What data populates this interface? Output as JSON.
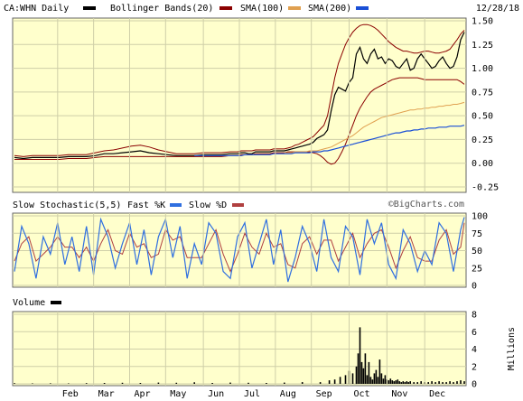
{
  "header": {
    "symbol_label": "CA:WHN Daily",
    "bb_label": "Bollinger Bands(20)",
    "sma100_label": "SMA(100)",
    "sma200_label": "SMA(200)",
    "date_label": "12/28/18"
  },
  "stoch_header": {
    "title": "Slow Stochastic(5,5)",
    "fast_label": "Fast %K",
    "slow_label": "Slow %D"
  },
  "volume_header": {
    "title": "Volume"
  },
  "watermark": "©BigCharts.com",
  "colors": {
    "panel_bg": "#ffffcc",
    "price": "#000000",
    "bollinger": "#8b0000",
    "sma100": "#e0a050",
    "sma200": "#1a4fd6",
    "fast_k": "#2f6fe0",
    "slow_d": "#b04040",
    "volume": "#000000"
  },
  "chart_data": [
    {
      "type": "line",
      "name": "price",
      "x_ticks": [
        "Feb",
        "Mar",
        "Apr",
        "May",
        "Jun",
        "Jul",
        "Aug",
        "Sep",
        "Oct",
        "Nov",
        "Dec"
      ],
      "y_ticks": [
        "1.50",
        "1.25",
        "1.00",
        "0.75",
        "0.50",
        "0.25",
        "0.00",
        "-0.25"
      ],
      "ylim": [
        -0.25,
        1.5
      ],
      "x_points": [
        0,
        10,
        20,
        30,
        40,
        50,
        60,
        70,
        80,
        90,
        100,
        110,
        120,
        130,
        140,
        150,
        160,
        170,
        180,
        190,
        200,
        210,
        220,
        230,
        240,
        248,
        252,
        256,
        260,
        264,
        268,
        272,
        276,
        280,
        284,
        288,
        292,
        296,
        300,
        304,
        308,
        312,
        316,
        320,
        324,
        328,
        332,
        336,
        340,
        344,
        348,
        352,
        356,
        360,
        364,
        368,
        372,
        376,
        380,
        384,
        388,
        392,
        396,
        400,
        404,
        408,
        412,
        416,
        420,
        424,
        428,
        432,
        436,
        440,
        444,
        448,
        452,
        456,
        460,
        464,
        468,
        472,
        476,
        480,
        484,
        488,
        492,
        496,
        500
      ],
      "series": [
        {
          "name": "CA:WHN Daily",
          "values": [
            0.06,
            0.05,
            0.06,
            0.06,
            0.06,
            0.06,
            0.07,
            0.07,
            0.07,
            0.08,
            0.1,
            0.1,
            0.11,
            0.12,
            0.13,
            0.11,
            0.1,
            0.09,
            0.08,
            0.08,
            0.08,
            0.09,
            0.09,
            0.09,
            0.1,
            0.1,
            0.11,
            0.11,
            0.1,
            0.1,
            0.12,
            0.12,
            0.12,
            0.12,
            0.12,
            0.13,
            0.13,
            0.13,
            0.13,
            0.14,
            0.15,
            0.16,
            0.17,
            0.18,
            0.19,
            0.2,
            0.22,
            0.26,
            0.28,
            0.3,
            0.35,
            0.55,
            0.72,
            0.8,
            0.78,
            0.76,
            0.85,
            0.9,
            1.15,
            1.22,
            1.1,
            1.05,
            1.15,
            1.2,
            1.1,
            1.12,
            1.05,
            1.1,
            1.08,
            1.02,
            1.0,
            1.05,
            1.1,
            0.98,
            1.0,
            1.1,
            1.15,
            1.1,
            1.05,
            1.0,
            1.02,
            1.08,
            1.12,
            1.05,
            1.0,
            1.02,
            1.12,
            1.3,
            1.38
          ]
        },
        {
          "name": "Bollinger Bands(20) upper",
          "values": [
            0.08,
            0.07,
            0.08,
            0.08,
            0.08,
            0.08,
            0.09,
            0.09,
            0.09,
            0.11,
            0.13,
            0.14,
            0.16,
            0.18,
            0.19,
            0.17,
            0.14,
            0.12,
            0.1,
            0.1,
            0.1,
            0.11,
            0.11,
            0.11,
            0.12,
            0.12,
            0.13,
            0.13,
            0.13,
            0.13,
            0.14,
            0.14,
            0.14,
            0.14,
            0.14,
            0.15,
            0.15,
            0.15,
            0.15,
            0.16,
            0.17,
            0.19,
            0.2,
            0.22,
            0.24,
            0.26,
            0.28,
            0.32,
            0.36,
            0.4,
            0.5,
            0.7,
            0.9,
            1.05,
            1.15,
            1.25,
            1.32,
            1.38,
            1.42,
            1.45,
            1.46,
            1.46,
            1.45,
            1.43,
            1.4,
            1.36,
            1.32,
            1.28,
            1.25,
            1.22,
            1.2,
            1.18,
            1.18,
            1.17,
            1.16,
            1.16,
            1.17,
            1.18,
            1.18,
            1.17,
            1.16,
            1.16,
            1.17,
            1.18,
            1.2,
            1.25,
            1.3,
            1.36,
            1.4
          ]
        },
        {
          "name": "Bollinger Bands(20) lower",
          "values": [
            0.04,
            0.04,
            0.04,
            0.04,
            0.04,
            0.04,
            0.05,
            0.05,
            0.05,
            0.06,
            0.07,
            0.07,
            0.07,
            0.07,
            0.07,
            0.07,
            0.07,
            0.07,
            0.07,
            0.07,
            0.07,
            0.07,
            0.07,
            0.07,
            0.08,
            0.08,
            0.09,
            0.09,
            0.09,
            0.09,
            0.1,
            0.1,
            0.1,
            0.1,
            0.1,
            0.11,
            0.11,
            0.11,
            0.11,
            0.12,
            0.12,
            0.12,
            0.12,
            0.12,
            0.12,
            0.12,
            0.11,
            0.1,
            0.08,
            0.05,
            0.01,
            -0.01,
            0.0,
            0.05,
            0.12,
            0.2,
            0.3,
            0.4,
            0.5,
            0.58,
            0.64,
            0.7,
            0.75,
            0.78,
            0.8,
            0.82,
            0.84,
            0.86,
            0.88,
            0.89,
            0.9,
            0.9,
            0.9,
            0.9,
            0.9,
            0.9,
            0.89,
            0.88,
            0.88,
            0.88,
            0.88,
            0.88,
            0.88,
            0.88,
            0.88,
            0.88,
            0.88,
            0.86,
            0.83
          ]
        },
        {
          "name": "SMA(100)",
          "values": [
            null,
            null,
            null,
            null,
            null,
            null,
            null,
            null,
            null,
            null,
            null,
            null,
            null,
            null,
            null,
            null,
            null,
            null,
            null,
            null,
            null,
            null,
            null,
            null,
            null,
            null,
            null,
            null,
            null,
            null,
            null,
            null,
            null,
            null,
            null,
            null,
            null,
            null,
            0.11,
            0.11,
            0.11,
            0.12,
            0.12,
            0.12,
            0.12,
            0.13,
            0.13,
            0.13,
            0.14,
            0.15,
            0.16,
            0.17,
            0.19,
            0.21,
            0.23,
            0.25,
            0.27,
            0.29,
            0.32,
            0.35,
            0.38,
            0.4,
            0.42,
            0.44,
            0.46,
            0.48,
            0.49,
            0.5,
            0.51,
            0.52,
            0.53,
            0.54,
            0.55,
            0.56,
            0.56,
            0.57,
            0.57,
            0.58,
            0.58,
            0.59,
            0.59,
            0.6,
            0.6,
            0.61,
            0.61,
            0.62,
            0.62,
            0.63,
            0.64
          ]
        },
        {
          "name": "SMA(200)",
          "values": [
            null,
            null,
            null,
            null,
            null,
            null,
            null,
            null,
            null,
            null,
            null,
            null,
            null,
            null,
            null,
            null,
            null,
            null,
            null,
            null,
            0.08,
            0.08,
            0.08,
            0.08,
            0.08,
            0.08,
            0.08,
            0.09,
            0.09,
            0.09,
            0.09,
            0.09,
            0.09,
            0.09,
            0.09,
            0.1,
            0.1,
            0.1,
            0.1,
            0.1,
            0.1,
            0.11,
            0.11,
            0.11,
            0.11,
            0.11,
            0.12,
            0.12,
            0.12,
            0.13,
            0.13,
            0.14,
            0.15,
            0.16,
            0.17,
            0.18,
            0.19,
            0.2,
            0.21,
            0.22,
            0.23,
            0.24,
            0.25,
            0.26,
            0.27,
            0.28,
            0.29,
            0.3,
            0.31,
            0.32,
            0.32,
            0.33,
            0.34,
            0.34,
            0.35,
            0.35,
            0.36,
            0.36,
            0.37,
            0.37,
            0.37,
            0.38,
            0.38,
            0.38,
            0.39,
            0.39,
            0.39,
            0.39,
            0.4
          ]
        }
      ]
    },
    {
      "type": "line",
      "name": "stochastic",
      "y_ticks": [
        "100",
        "75",
        "50",
        "25",
        "0"
      ],
      "ylim": [
        0,
        100
      ],
      "x_points": [
        0,
        8,
        16,
        24,
        32,
        40,
        48,
        56,
        64,
        72,
        80,
        88,
        96,
        104,
        112,
        120,
        128,
        136,
        144,
        152,
        160,
        168,
        176,
        184,
        192,
        200,
        208,
        216,
        224,
        232,
        240,
        248,
        256,
        264,
        272,
        280,
        288,
        296,
        304,
        312,
        320,
        328,
        336,
        344,
        352,
        360,
        368,
        376,
        384,
        392,
        400,
        408,
        416,
        424,
        432,
        440,
        448,
        456,
        464,
        472,
        480,
        488,
        496,
        500
      ],
      "series": [
        {
          "name": "Fast %K",
          "values": [
            20,
            85,
            60,
            10,
            70,
            45,
            90,
            30,
            70,
            20,
            85,
            15,
            95,
            70,
            25,
            60,
            90,
            30,
            80,
            15,
            70,
            95,
            40,
            85,
            10,
            60,
            30,
            90,
            75,
            20,
            10,
            70,
            90,
            25,
            60,
            95,
            30,
            80,
            5,
            40,
            85,
            60,
            20,
            95,
            40,
            20,
            85,
            70,
            15,
            95,
            60,
            90,
            30,
            10,
            80,
            60,
            20,
            50,
            30,
            90,
            75,
            20,
            80,
            98
          ]
        },
        {
          "name": "Slow %D",
          "values": [
            35,
            60,
            70,
            35,
            45,
            55,
            70,
            55,
            55,
            40,
            55,
            35,
            60,
            80,
            50,
            45,
            75,
            55,
            60,
            40,
            45,
            80,
            65,
            70,
            40,
            40,
            40,
            60,
            80,
            45,
            20,
            45,
            75,
            55,
            45,
            75,
            55,
            60,
            30,
            25,
            60,
            70,
            45,
            65,
            65,
            35,
            55,
            75,
            40,
            60,
            75,
            80,
            55,
            25,
            50,
            70,
            40,
            35,
            35,
            65,
            80,
            45,
            55,
            90
          ]
        }
      ]
    },
    {
      "type": "bar",
      "name": "volume",
      "y_ticks": [
        "8",
        "6",
        "4",
        "2",
        "0"
      ],
      "ylabel": "Millions",
      "ylim": [
        0,
        8
      ],
      "x_points": [
        0,
        20,
        40,
        60,
        80,
        100,
        120,
        140,
        160,
        180,
        200,
        220,
        240,
        260,
        280,
        300,
        320,
        340,
        350,
        356,
        362,
        368,
        372,
        376,
        380,
        382,
        384,
        386,
        388,
        390,
        392,
        394,
        396,
        398,
        400,
        402,
        404,
        406,
        408,
        410,
        412,
        414,
        416,
        418,
        420,
        422,
        424,
        426,
        428,
        430,
        432,
        434,
        436,
        438,
        440,
        444,
        448,
        452,
        456,
        460,
        464,
        468,
        472,
        476,
        480,
        484,
        488,
        492,
        496,
        500
      ],
      "values": [
        0.08,
        0.05,
        0.06,
        0.05,
        0.08,
        0.1,
        0.12,
        0.1,
        0.15,
        0.12,
        0.18,
        0.1,
        0.15,
        0.12,
        0.1,
        0.15,
        0.2,
        0.2,
        0.4,
        0.5,
        0.8,
        1.0,
        1.5,
        1.2,
        2.0,
        3.5,
        6.5,
        2.5,
        1.8,
        3.5,
        1.0,
        2.5,
        0.8,
        0.5,
        1.2,
        1.6,
        0.8,
        2.8,
        1.2,
        0.6,
        1.0,
        0.5,
        0.4,
        0.6,
        0.4,
        0.3,
        0.4,
        0.5,
        0.3,
        0.2,
        0.3,
        0.2,
        0.3,
        0.2,
        0.3,
        0.2,
        0.2,
        0.3,
        0.2,
        0.2,
        0.3,
        0.2,
        0.3,
        0.2,
        0.2,
        0.3,
        0.2,
        0.3,
        0.4,
        0.3
      ]
    }
  ]
}
